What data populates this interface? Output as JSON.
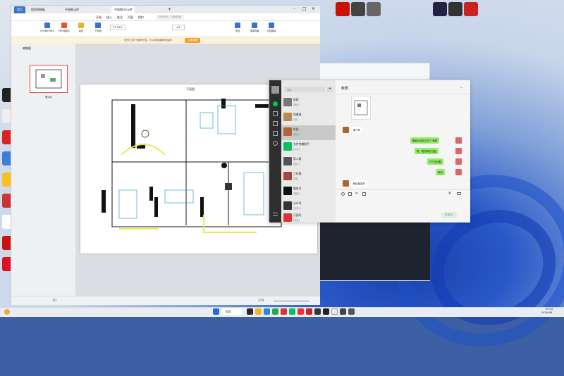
{
  "wps": {
    "tabs": [
      "首页",
      "找稻壳模板",
      "平面图.pdf",
      "平面图(2).pdf"
    ],
    "menu": [
      "开始",
      "插入",
      "批注",
      "页面",
      "保护",
      "转换",
      "编辑",
      "工具",
      "会员专享"
    ],
    "search_placeholder": "查找命令、搜索模板",
    "tools": [
      "PDF转Office",
      "PDF转图片",
      "高亮",
      "下划线",
      "删除线",
      "插入文本",
      "旋转文档",
      "单页",
      "双页",
      "连续阅读",
      "自动滚动",
      "截图和对比",
      "查找",
      "设置背景",
      "文档翻译"
    ],
    "zoom": "37.35%",
    "page_input": "1/1",
    "notice": "您的文档已转换完成，可以继续编辑或保存",
    "notice_btn": "立即查看",
    "sidebar_title": "缩略图",
    "thumb_label": "第1页",
    "status_page": "1/1",
    "status_zoom": "37%",
    "plan_title": "平面图"
  },
  "wechat": {
    "chat_title": "秋阳",
    "search_placeholder": "搜索",
    "contacts": [
      {
        "name": "秋阳",
        "preview": "[图片]"
      },
      {
        "name": "同事群",
        "preview": "好的"
      },
      {
        "name": "秋阳",
        "preview": "[图片]"
      },
      {
        "name": "文件传输助手",
        "preview": "[文件]"
      },
      {
        "name": "家人群",
        "preview": "[图片]"
      },
      {
        "name": "工作群",
        "preview": "收到"
      },
      {
        "name": "服务号",
        "preview": "[链接]"
      },
      {
        "name": "公众号",
        "preview": "[文章]"
      },
      {
        "name": "订阅号",
        "preview": "[消息]"
      }
    ],
    "messages_in": [
      "看了吗",
      "稍后回复你"
    ],
    "messages_out": [
      "图纸已经发过去了 看看",
      "嗯，看完再说 回复",
      "尺寸没问题",
      "收到"
    ],
    "send_label": "发送(S)"
  },
  "taskbar": {
    "search_label": "搜索",
    "time": "09:52",
    "date": "2024/4/6"
  }
}
